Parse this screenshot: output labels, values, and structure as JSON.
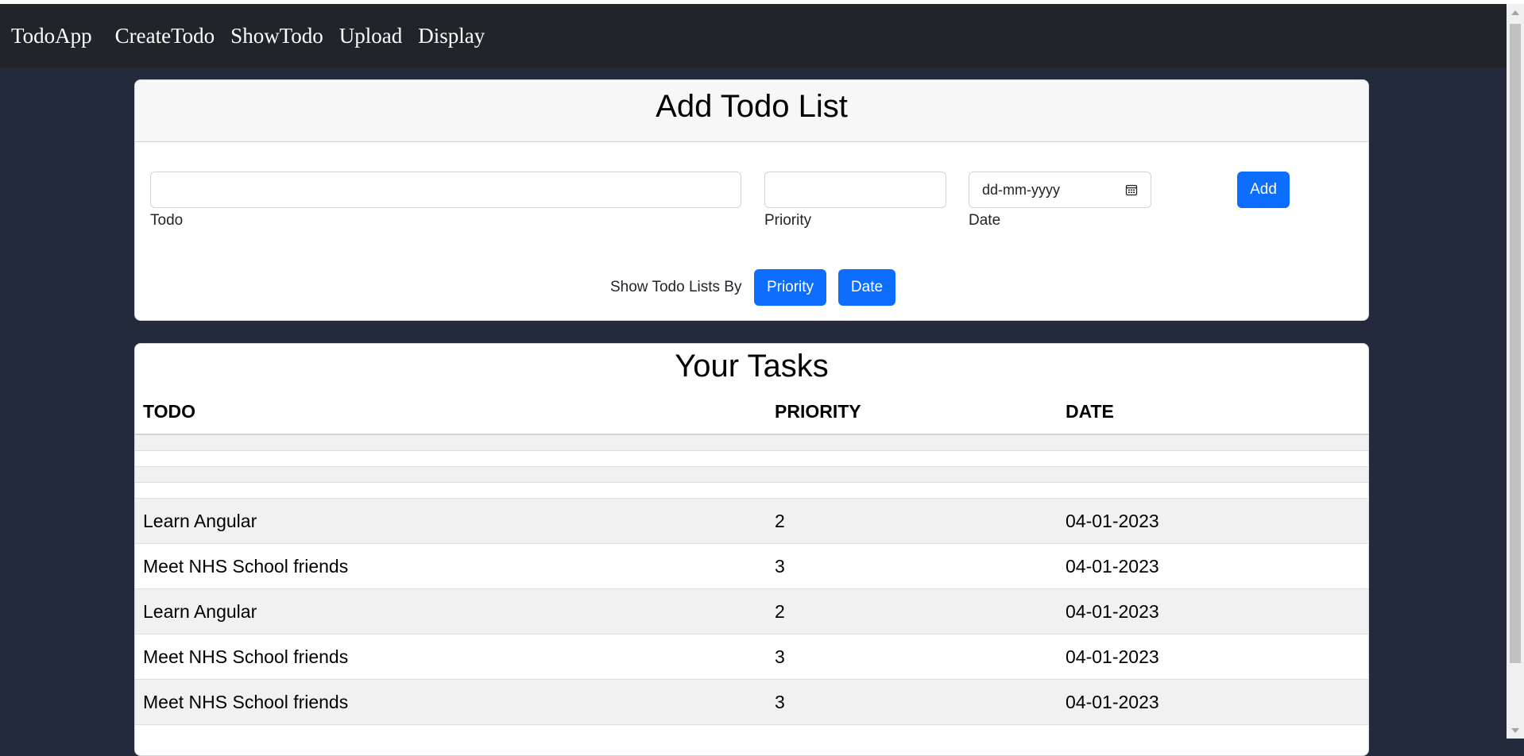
{
  "navbar": {
    "brand": "TodoApp",
    "links": [
      "CreateTodo",
      "ShowTodo",
      "Upload",
      "Display"
    ]
  },
  "add_form": {
    "title": "Add Todo List",
    "todo_label": "Todo",
    "todo_value": "",
    "priority_label": "Priority",
    "priority_value": "",
    "date_label": "Date",
    "date_placeholder": "dd-mm-yyyy",
    "add_button": "Add",
    "show_by_label": "Show Todo Lists By",
    "sort_priority_button": "Priority",
    "sort_date_button": "Date"
  },
  "tasks": {
    "title": "Your Tasks",
    "columns": [
      "TODO",
      "PRIORITY",
      "DATE"
    ],
    "rows": [
      [
        "",
        "",
        ""
      ],
      [
        "",
        "",
        ""
      ],
      [
        "",
        "",
        ""
      ],
      [
        "",
        "",
        ""
      ],
      [
        "Learn Angular",
        "2",
        "04-01-2023"
      ],
      [
        "Meet NHS School friends",
        "3",
        "04-01-2023"
      ],
      [
        "Learn Angular",
        "2",
        "04-01-2023"
      ],
      [
        "Meet NHS School friends",
        "3",
        "04-01-2023"
      ],
      [
        "Meet NHS School friends",
        "3",
        "04-01-2023"
      ]
    ]
  },
  "colors": {
    "page_bg": "#222a3c",
    "navbar_bg": "#212529",
    "primary": "#0d6efd"
  },
  "icons": {
    "date_picker": "calendar-icon"
  }
}
